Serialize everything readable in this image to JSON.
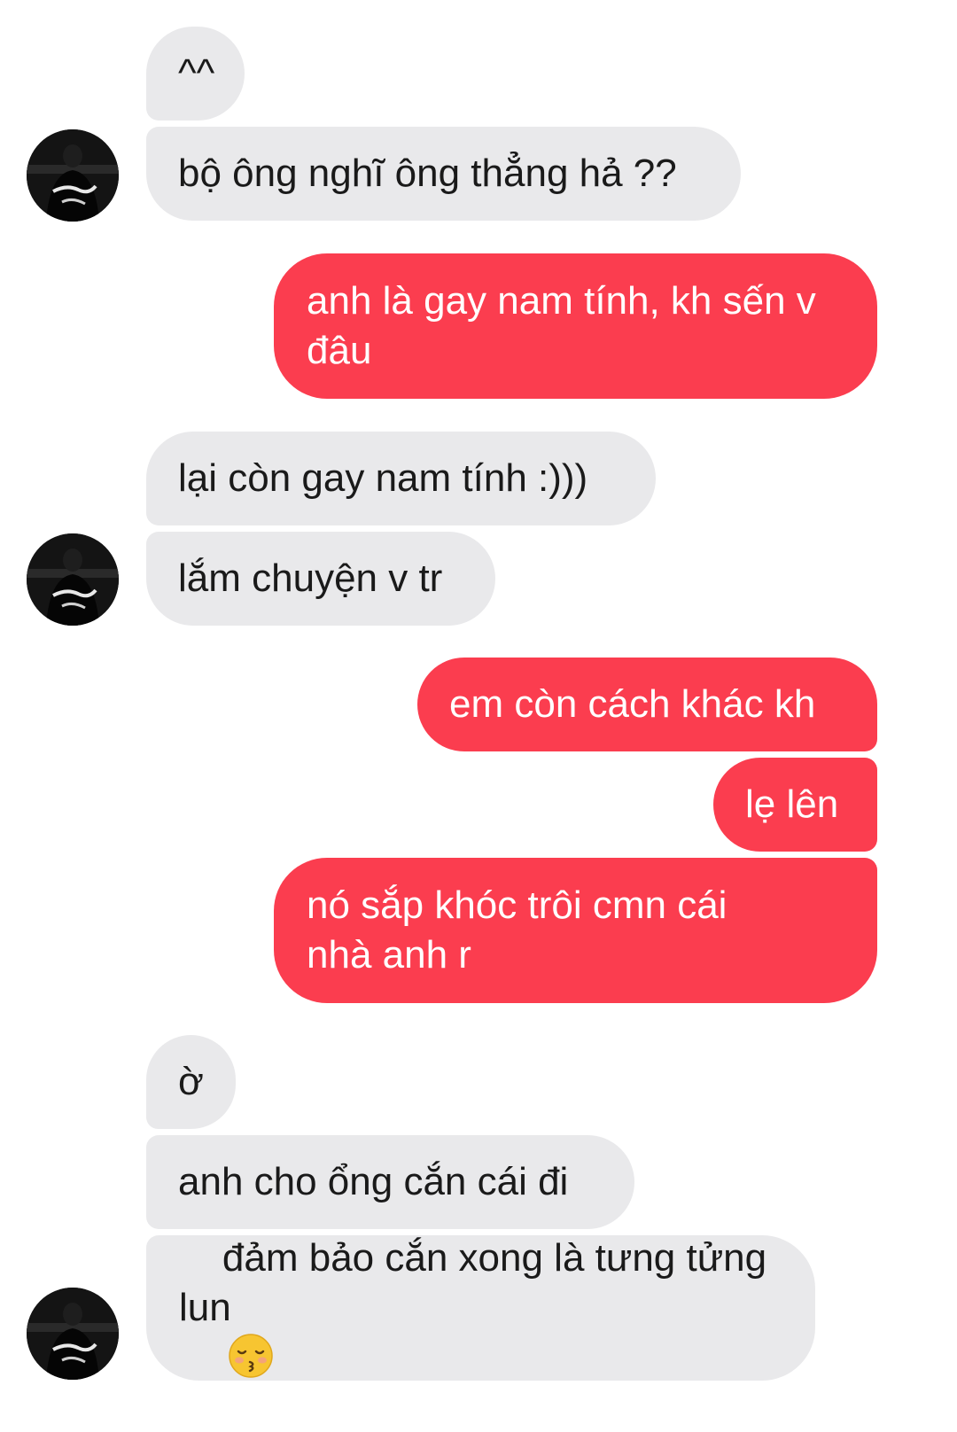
{
  "colors": {
    "incoming_bubble": "#e9e9eb",
    "outgoing_bubble": "#fb3d4f",
    "background": "#ffffff"
  },
  "conversation": {
    "messages": [
      {
        "side": "incoming",
        "text": "^^"
      },
      {
        "side": "incoming",
        "text": "bộ ông nghĩ ông thẳng hả ??"
      },
      {
        "side": "outgoing",
        "text": "anh là gay nam tính, kh sến v đâu"
      },
      {
        "side": "incoming",
        "text": "lại còn gay nam tính :)))"
      },
      {
        "side": "incoming",
        "text": "lắm chuyện v tr"
      },
      {
        "side": "outgoing",
        "text": "em còn cách khác kh"
      },
      {
        "side": "outgoing",
        "text": "lẹ lên"
      },
      {
        "side": "outgoing",
        "text": "nó sắp khóc trôi cmn cái nhà anh r"
      },
      {
        "side": "incoming",
        "text": "ờ"
      },
      {
        "side": "incoming",
        "text": "anh cho ổng cắn cái đi"
      },
      {
        "side": "incoming",
        "text": "đảm bảo cắn xong là tưng tửng lun",
        "emoji": "kissing-face-with-closed-eyes-icon"
      }
    ],
    "avatar_icon": "contact-avatar-photo"
  }
}
